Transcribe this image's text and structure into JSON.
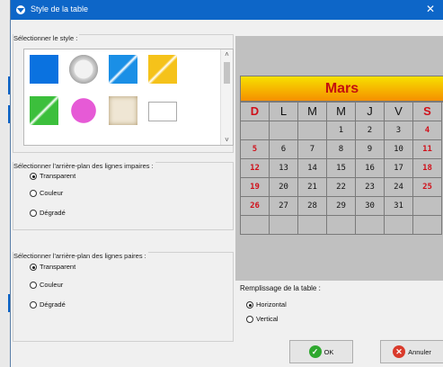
{
  "window": {
    "title": "Style de la table",
    "close_glyph": "✕"
  },
  "style_section": {
    "label": "Sélectionner le style :",
    "swatches": [
      {
        "name": "blue-flat-swatch",
        "color": "#0a72e0"
      },
      {
        "name": "silver-seal-swatch",
        "color": "#d6d6d6"
      },
      {
        "name": "blue-gloss-swatch",
        "color": "#1a8fe6"
      },
      {
        "name": "yellow-gloss-swatch",
        "color": "#f5c21a"
      },
      {
        "name": "green-gloss-swatch",
        "color": "#3cbf3c"
      },
      {
        "name": "pink-circle-swatch",
        "color": "#e65ad6"
      },
      {
        "name": "parchment-swatch",
        "color": "#efe6d4"
      },
      {
        "name": "white-swatch",
        "color": "#ffffff"
      }
    ]
  },
  "odd_rows": {
    "label": "Sélectionner l'arrière-plan des lignes impaires :",
    "options": [
      "Transparent",
      "Couleur",
      "Dégradé"
    ],
    "selected": 0
  },
  "even_rows": {
    "label": "Sélectionner l'arrière-plan des lignes paires :",
    "options": [
      "Transparent",
      "Couleur",
      "Dégradé"
    ],
    "selected": 0
  },
  "calendar": {
    "month": "Mars",
    "headers": [
      "D",
      "L",
      "M",
      "M",
      "J",
      "V",
      "S"
    ],
    "weeks": [
      [
        "",
        "",
        "",
        "1",
        "2",
        "3",
        "4"
      ],
      [
        "5",
        "6",
        "7",
        "8",
        "9",
        "10",
        "11"
      ],
      [
        "12",
        "13",
        "14",
        "15",
        "16",
        "17",
        "18"
      ],
      [
        "19",
        "20",
        "21",
        "22",
        "23",
        "24",
        "25"
      ],
      [
        "26",
        "27",
        "28",
        "29",
        "30",
        "31",
        ""
      ],
      [
        "",
        "",
        "",
        "",
        "",
        "",
        ""
      ]
    ],
    "header_colors": {
      "weekend": "#d0101a",
      "weekday": "#111111"
    }
  },
  "fill": {
    "label": "Remplissage de la table :",
    "options": [
      "Horizontal",
      "Vertical"
    ],
    "selected": 0
  },
  "buttons": {
    "ok": "OK",
    "cancel": "Annuler"
  }
}
